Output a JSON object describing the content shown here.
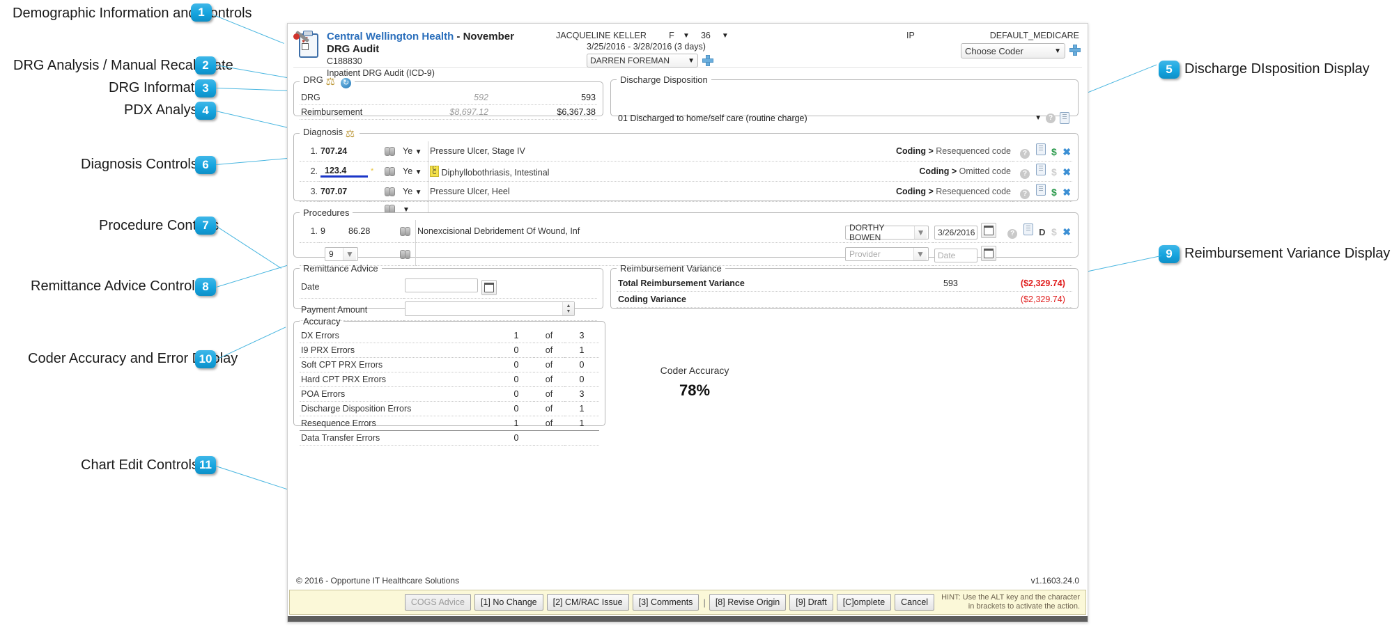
{
  "annotations": [
    {
      "n": "1",
      "label": "Demographic Information and Controls"
    },
    {
      "n": "2",
      "label": "DRG Analysis / Manual Recalculate"
    },
    {
      "n": "3",
      "label": "DRG Information"
    },
    {
      "n": "4",
      "label": "PDX Analysis"
    },
    {
      "n": "5",
      "label": "Discharge DIsposition Display"
    },
    {
      "n": "6",
      "label": "Diagnosis Controls"
    },
    {
      "n": "7",
      "label": "Procedure Controls"
    },
    {
      "n": "8",
      "label": "Remittance Advice Controls"
    },
    {
      "n": "9",
      "label": "Reimbursement Variance Display"
    },
    {
      "n": "10",
      "label": "Coder Accuracy and Error Display"
    },
    {
      "n": "11",
      "label": "Chart Edit Controls"
    }
  ],
  "header": {
    "facility": "Central Wellington Health",
    "audit_name": "- November DRG Audit",
    "account": "C188830",
    "audit_type": "Inpatient DRG Audit (ICD-9)",
    "patient_name": "JACQUELINE KELLER",
    "sex": "F",
    "age": "36",
    "stay_dates": "3/25/2016 - 3/28/2016 (3 days)",
    "coder_value": "DARREN FOREMAN",
    "patient_type": "IP",
    "payer": "DEFAULT_MEDICARE",
    "choose_coder": "Choose Coder"
  },
  "drg": {
    "legend": "DRG",
    "rows": [
      {
        "label": "DRG",
        "original": "592",
        "current": "593"
      },
      {
        "label": "Reimbursement",
        "original": "$8,697.12",
        "current": "$6,367.38"
      }
    ]
  },
  "discharge": {
    "legend": "Discharge Disposition",
    "value": "01 Discharged to home/self care (routine charge)"
  },
  "diagnosis": {
    "legend": "Diagnosis",
    "rows": [
      {
        "num": "1.",
        "code": "707.24",
        "star": "",
        "poa": "Ye",
        "desc": "Pressure Ulcer, Stage IV",
        "hcc": false,
        "note_prefix": "Coding >",
        "note": "Resequenced code",
        "dollar_active": true,
        "editing": false
      },
      {
        "num": "2.",
        "code": "123.4",
        "star": "*",
        "poa": "Ye",
        "desc": "Diphyllobothriasis, Intestinal",
        "hcc": true,
        "note_prefix": "Coding >",
        "note": "Omitted code",
        "dollar_active": false,
        "editing": true
      },
      {
        "num": "3.",
        "code": "707.07",
        "star": "",
        "poa": "Ye",
        "desc": "Pressure Ulcer, Heel",
        "hcc": false,
        "note_prefix": "Coding >",
        "note": "Resequenced code",
        "dollar_active": true,
        "editing": false
      }
    ]
  },
  "procedures": {
    "legend": "Procedures",
    "rows": [
      {
        "num": "1.",
        "version": "9",
        "code": "86.28",
        "desc": "Nonexcisional Debridement Of Wound, Inf",
        "provider": "DORTHY BOWEN",
        "date": "3/26/2016"
      }
    ],
    "new_row": {
      "version": "9",
      "provider_placeholder": "Provider",
      "date_placeholder": "Date"
    }
  },
  "remittance": {
    "legend": "Remittance Advice",
    "date_label": "Date",
    "date_value": "",
    "payment_label": "Payment Amount",
    "payment_value": ""
  },
  "variance": {
    "legend": "Reimbursement Variance",
    "total_label": "Total Reimbursement Variance",
    "total_drg": "593",
    "total_amount": "($2,329.74)",
    "coding_label": "Coding Variance",
    "coding_amount": "($2,329.74)"
  },
  "accuracy": {
    "legend": "Accuracy",
    "of_label": "of",
    "rows": [
      {
        "label": "DX Errors",
        "n": "1",
        "d": "3"
      },
      {
        "label": "I9 PRX Errors",
        "n": "0",
        "d": "1"
      },
      {
        "label": "Soft CPT PRX Errors",
        "n": "0",
        "d": "0"
      },
      {
        "label": "Hard CPT PRX Errors",
        "n": "0",
        "d": "0"
      },
      {
        "label": "POA Errors",
        "n": "0",
        "d": "3"
      },
      {
        "label": "Discharge Disposition Errors",
        "n": "0",
        "d": "1"
      },
      {
        "label": "Resequence Errors",
        "n": "1",
        "d": "1"
      }
    ],
    "last_row": {
      "label": "Data Transfer Errors",
      "n": "0"
    },
    "coder_accuracy_label": "Coder Accuracy",
    "coder_accuracy_value": "78%"
  },
  "footer": {
    "copyright": "© 2016 - Opportune IT Healthcare Solutions",
    "version": "v1.1603.24.0",
    "buttons": [
      {
        "label": "COGS Advice",
        "disabled": true
      },
      {
        "label": "[1] No Change",
        "disabled": false
      },
      {
        "label": "[2] CM/RAC Issue",
        "disabled": false
      },
      {
        "label": "[3] Comments",
        "disabled": false
      },
      {
        "label": "[8] Revise Origin",
        "disabled": false
      },
      {
        "label": "[9] Draft",
        "disabled": false
      },
      {
        "label": "[C]omplete",
        "disabled": false
      },
      {
        "label": "Cancel",
        "disabled": false
      }
    ],
    "hint": "HINT: Use the ALT key and the character\nin brackets to activate the action."
  },
  "colors": {
    "accent": "#29ABE2",
    "link": "#2a6ebb",
    "negative": "#e01b1b",
    "hint_bg": "#fbf8d8"
  }
}
